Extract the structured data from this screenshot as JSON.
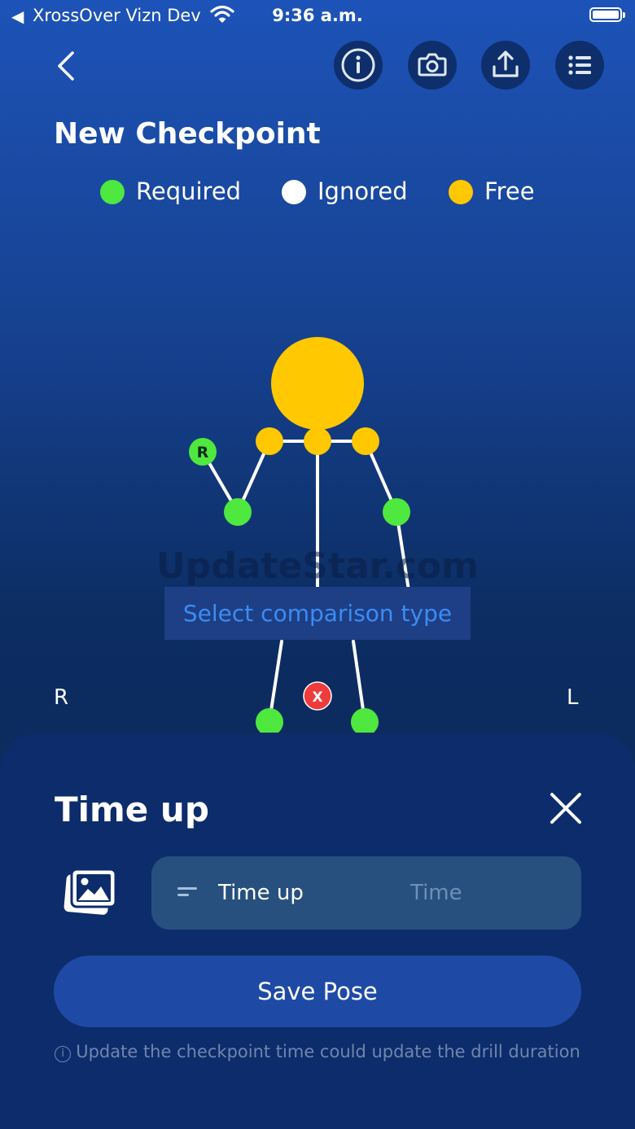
{
  "status_bar": {
    "back_glyph": "◀",
    "carrier": "XrossOver Vizn Dev",
    "time": "9:36 a.m.",
    "wifi_icon": "wifi-icon",
    "battery_icon": "battery-icon"
  },
  "header": {
    "back_icon": "chevron-left-icon",
    "icons": [
      "info-icon",
      "camera-icon",
      "share-icon",
      "list-icon"
    ],
    "title": "New Checkpoint"
  },
  "legend": [
    {
      "label": "Required",
      "color": "#4ee83f"
    },
    {
      "label": "Ignored",
      "color": "#ffffff"
    },
    {
      "label": "Free",
      "color": "#ffc800"
    }
  ],
  "figure": {
    "colors": {
      "required": "#4ee83f",
      "free": "#ffc800",
      "remove": "#ef3b3b",
      "line": "#ffffff"
    },
    "marker_letter": "R",
    "remove_glyph": "X",
    "side_right": "R",
    "side_left": "L"
  },
  "watermark": "UpdateStar.com",
  "comparison_button": "Select comparison type",
  "sheet": {
    "title": "Time up",
    "close_icon": "close-icon",
    "image_icon": "image-icon",
    "time_field": {
      "value": "Time up",
      "placeholder": "Time"
    },
    "save_label": "Save Pose",
    "footnote_icon": "ⓘ",
    "footnote": "Update the checkpoint time could update the drill duration"
  }
}
